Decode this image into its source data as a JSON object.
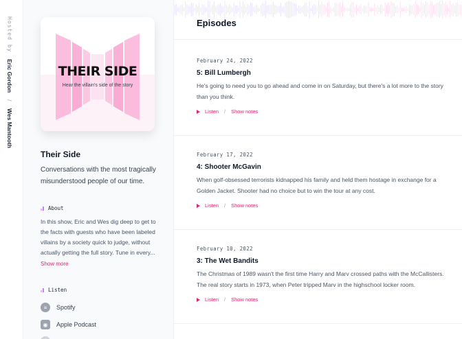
{
  "hosts": {
    "hosted_by": "Hosted by",
    "host1": "Eric Gordon",
    "separator": "/",
    "host2": "Wes Mantooth"
  },
  "cover": {
    "title": "THEIR SIDE",
    "subtitle": "Hear the villain's side of the story"
  },
  "podcast": {
    "title": "Their Side",
    "description": "Conversations with the most tragically misunderstood people of our time."
  },
  "about": {
    "heading": "About",
    "text": "In this show, Eric and Wes dig deep to get to the facts with guests who have been labeled villains by a society quick to judge, without actually getting the full story. Tune in every...",
    "show_more": "Show more"
  },
  "listen": {
    "heading": "Listen",
    "items": [
      {
        "label": "Spotify",
        "icon": "spotify-icon"
      },
      {
        "label": "Apple Podcast",
        "icon": "apple-podcast-icon"
      }
    ]
  },
  "main": {
    "title": "Episodes",
    "listen_label": "Listen",
    "separator": "/",
    "notes_label": "Show notes"
  },
  "episodes": [
    {
      "date": "February 24, 2022",
      "title": "5: Bill Lumbergh",
      "description": "He's going to need you to go ahead and come in on Saturday, but there's a lot more to the story than you think."
    },
    {
      "date": "February 17, 2022",
      "title": "4: Shooter McGavin",
      "description": "When golf-obsessed terrorists kidnapped his family and held them hostage in exchange for a Golden Jacket. Shooter had no choice but to win the tour at any cost."
    },
    {
      "date": "February 10, 2022",
      "title": "3: The Wet Bandits",
      "description": "The Christmas of 1989 wasn't the first time Harry and Marv crossed paths with the McCallisters. The real story starts in 1973, when Peter tripped Marv in the highschool locker room."
    }
  ],
  "colors": {
    "accent": "#db2777",
    "sidebar_bg": "#f8fafc"
  }
}
